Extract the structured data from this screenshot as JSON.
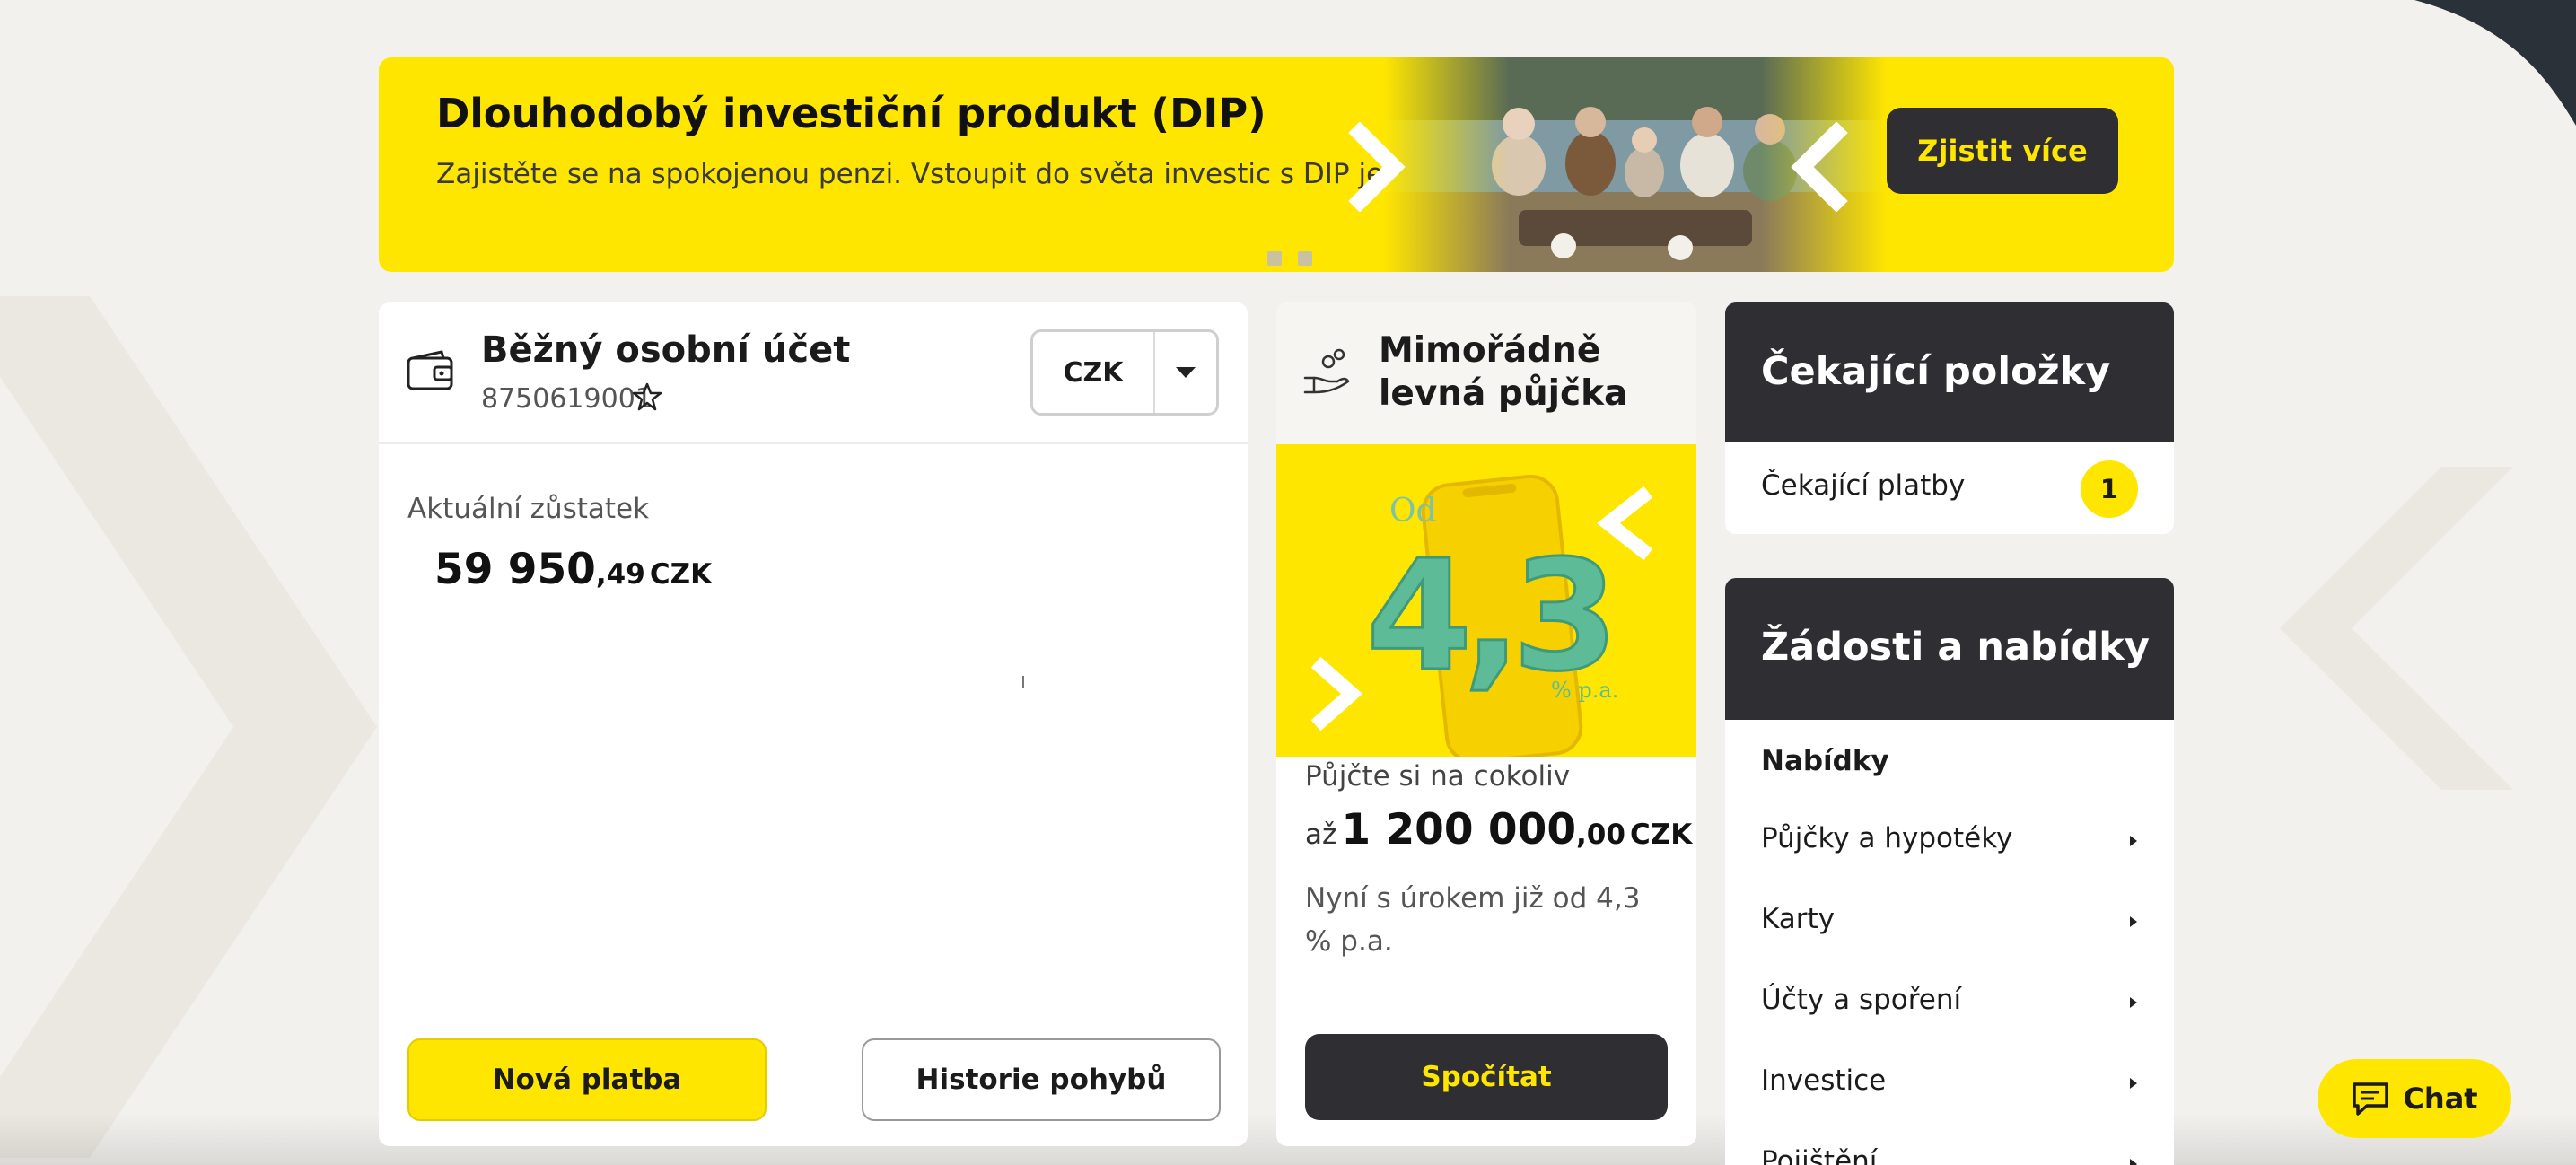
{
  "banner": {
    "title": "Dlouhodobý investiční produkt (DIP)",
    "subtitle": "Zajistěte se na spokojenou penzi. Vstoupit do světa investic s DIP je snadné.",
    "cta_label": "Zjistit více",
    "slides": 2
  },
  "account": {
    "name": "Běžný osobní účet",
    "number": "8750619001",
    "currency": "CZK",
    "balance_label": "Aktuální zůstatek",
    "balance_int": "59 950",
    "balance_dec": ",49",
    "balance_currency": "CZK",
    "new_payment_label": "Nová platba",
    "history_label": "Historie pohybů"
  },
  "loan": {
    "title": "Mimořádně levná půjčka",
    "image_prefix": "Od",
    "image_rate": "4,3",
    "image_unit": "% p.a.",
    "lead": "Půjčte si na cokoliv",
    "amount_prefix": "až",
    "amount_int": "1 200 000",
    "amount_dec": ",00",
    "amount_currency": "CZK",
    "note": "Nyní s úrokem již od 4,3 % p.a.",
    "cta_label": "Spočítat"
  },
  "pending": {
    "title": "Čekající položky",
    "payments_label": "Čekající platby",
    "payments_count": "1"
  },
  "requests": {
    "title": "Žádosti a nabídky",
    "offers_heading": "Nabídky",
    "items": [
      {
        "label": "Půjčky a hypotéky"
      },
      {
        "label": "Karty"
      },
      {
        "label": "Účty a spoření"
      },
      {
        "label": "Investice"
      },
      {
        "label": "Pojištění"
      }
    ]
  },
  "chat": {
    "label": "Chat"
  },
  "colors": {
    "brand_yellow": "#ffe600",
    "dark": "#2f2f33",
    "background": "#f2f1ee"
  }
}
